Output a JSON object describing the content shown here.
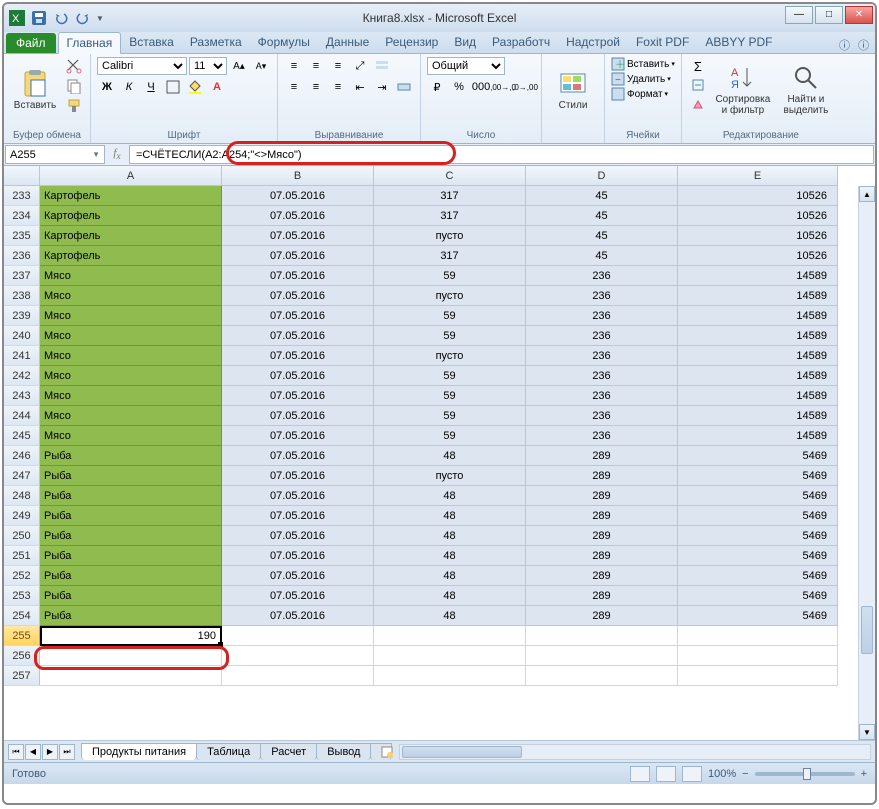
{
  "title": "Книга8.xlsx - Microsoft Excel",
  "qat": {
    "save": "💾",
    "undo": "↶",
    "redo": "↷"
  },
  "tabs": {
    "file": "Файл",
    "items": [
      "Главная",
      "Вставка",
      "Разметка",
      "Формулы",
      "Данные",
      "Рецензир",
      "Вид",
      "Разработч",
      "Надстрой",
      "Foxit PDF",
      "ABBYY PDF"
    ],
    "active": 0
  },
  "ribbon": {
    "clipboard": {
      "paste": "Вставить",
      "label": "Буфер обмена"
    },
    "font": {
      "name": "Calibri",
      "size": "11",
      "label": "Шрифт",
      "b": "Ж",
      "i": "К",
      "u": "Ч"
    },
    "align": {
      "label": "Выравнивание"
    },
    "number": {
      "format": "Общий",
      "label": "Число"
    },
    "styles": {
      "btn": "Стили",
      "label": ""
    },
    "cells": {
      "insert": "Вставить",
      "delete": "Удалить",
      "format": "Формат",
      "label": "Ячейки"
    },
    "editing": {
      "sort": "Сортировка\nи фильтр",
      "find": "Найти и\nвыделить",
      "label": "Редактирование"
    }
  },
  "namebox": "A255",
  "formula": "=СЧЁТЕСЛИ(A2:A254;\"<>Мясо\")",
  "columns": [
    "",
    "A",
    "B",
    "C",
    "D",
    "E"
  ],
  "rows": [
    {
      "n": 233,
      "a": "Картофель",
      "b": "07.05.2016",
      "c": "317",
      "d": "45",
      "e": "10526"
    },
    {
      "n": 234,
      "a": "Картофель",
      "b": "07.05.2016",
      "c": "317",
      "d": "45",
      "e": "10526"
    },
    {
      "n": 235,
      "a": "Картофель",
      "b": "07.05.2016",
      "c": "пусто",
      "d": "45",
      "e": "10526"
    },
    {
      "n": 236,
      "a": "Картофель",
      "b": "07.05.2016",
      "c": "317",
      "d": "45",
      "e": "10526"
    },
    {
      "n": 237,
      "a": "Мясо",
      "b": "07.05.2016",
      "c": "59",
      "d": "236",
      "e": "14589"
    },
    {
      "n": 238,
      "a": "Мясо",
      "b": "07.05.2016",
      "c": "пусто",
      "d": "236",
      "e": "14589"
    },
    {
      "n": 239,
      "a": "Мясо",
      "b": "07.05.2016",
      "c": "59",
      "d": "236",
      "e": "14589"
    },
    {
      "n": 240,
      "a": "Мясо",
      "b": "07.05.2016",
      "c": "59",
      "d": "236",
      "e": "14589"
    },
    {
      "n": 241,
      "a": "Мясо",
      "b": "07.05.2016",
      "c": "пусто",
      "d": "236",
      "e": "14589"
    },
    {
      "n": 242,
      "a": "Мясо",
      "b": "07.05.2016",
      "c": "59",
      "d": "236",
      "e": "14589"
    },
    {
      "n": 243,
      "a": "Мясо",
      "b": "07.05.2016",
      "c": "59",
      "d": "236",
      "e": "14589"
    },
    {
      "n": 244,
      "a": "Мясо",
      "b": "07.05.2016",
      "c": "59",
      "d": "236",
      "e": "14589"
    },
    {
      "n": 245,
      "a": "Мясо",
      "b": "07.05.2016",
      "c": "59",
      "d": "236",
      "e": "14589"
    },
    {
      "n": 246,
      "a": "Рыба",
      "b": "07.05.2016",
      "c": "48",
      "d": "289",
      "e": "5469"
    },
    {
      "n": 247,
      "a": "Рыба",
      "b": "07.05.2016",
      "c": "пусто",
      "d": "289",
      "e": "5469"
    },
    {
      "n": 248,
      "a": "Рыба",
      "b": "07.05.2016",
      "c": "48",
      "d": "289",
      "e": "5469"
    },
    {
      "n": 249,
      "a": "Рыба",
      "b": "07.05.2016",
      "c": "48",
      "d": "289",
      "e": "5469"
    },
    {
      "n": 250,
      "a": "Рыба",
      "b": "07.05.2016",
      "c": "48",
      "d": "289",
      "e": "5469"
    },
    {
      "n": 251,
      "a": "Рыба",
      "b": "07.05.2016",
      "c": "48",
      "d": "289",
      "e": "5469"
    },
    {
      "n": 252,
      "a": "Рыба",
      "b": "07.05.2016",
      "c": "48",
      "d": "289",
      "e": "5469"
    },
    {
      "n": 253,
      "a": "Рыба",
      "b": "07.05.2016",
      "c": "48",
      "d": "289",
      "e": "5469"
    },
    {
      "n": 254,
      "a": "Рыба",
      "b": "07.05.2016",
      "c": "48",
      "d": "289",
      "e": "5469"
    }
  ],
  "result_row": {
    "n": 255,
    "value": "190"
  },
  "empty_rows": [
    256,
    257
  ],
  "sheets": {
    "items": [
      "Продукты питания",
      "Таблица",
      "Расчет",
      "Вывод"
    ],
    "active": 0
  },
  "status": {
    "ready": "Готово",
    "zoom": "100%"
  }
}
